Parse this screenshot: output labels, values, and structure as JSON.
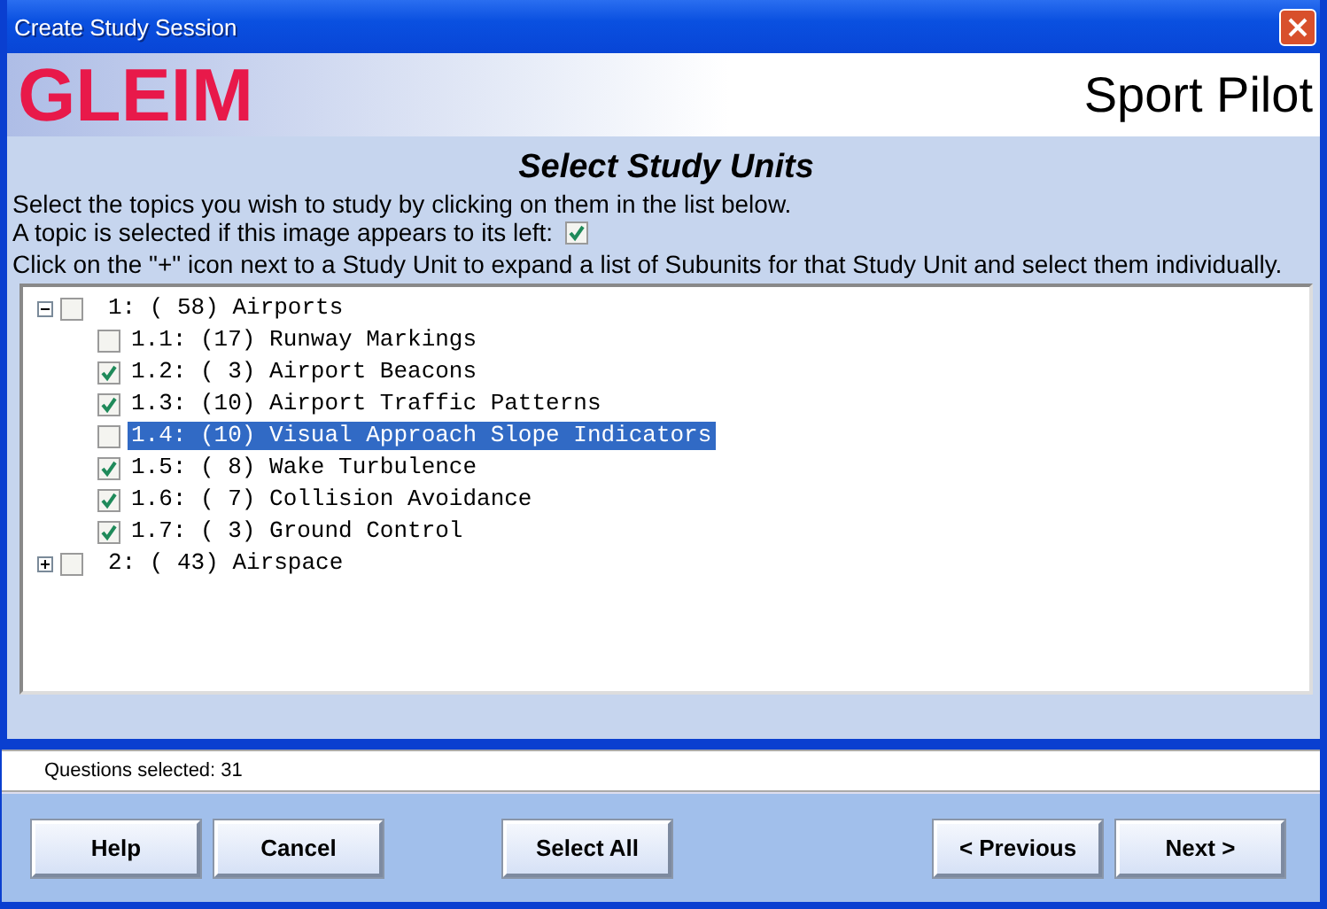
{
  "window": {
    "title": "Create Study Session"
  },
  "header": {
    "logo": "GLEIM",
    "product": "Sport Pilot"
  },
  "heading": "Select Study Units",
  "instructions": [
    "Select the topics you wish to study by clicking on them in the list below.",
    "A topic is selected if this image appears to its left:",
    "Click on the \"+\" icon next to a Study Unit to expand a list of Subunits for that Study Unit and select them individually."
  ],
  "legend_checked": true,
  "tree": [
    {
      "label": "1: ( 58) Airports",
      "expanded": true,
      "checked": false,
      "selected": false,
      "children": [
        {
          "label": "1.1: (17) Runway Markings",
          "checked": false,
          "selected": false
        },
        {
          "label": "1.2: ( 3) Airport Beacons",
          "checked": true,
          "selected": false
        },
        {
          "label": "1.3: (10) Airport Traffic Patterns",
          "checked": true,
          "selected": false
        },
        {
          "label": "1.4: (10) Visual Approach Slope Indicators",
          "checked": false,
          "selected": true
        },
        {
          "label": "1.5: ( 8) Wake Turbulence",
          "checked": true,
          "selected": false
        },
        {
          "label": "1.6: ( 7) Collision Avoidance",
          "checked": true,
          "selected": false
        },
        {
          "label": "1.7: ( 3) Ground Control",
          "checked": true,
          "selected": false
        }
      ]
    },
    {
      "label": "2: ( 43) Airspace",
      "expanded": false,
      "checked": false,
      "selected": false
    }
  ],
  "status_bar": "Questions selected: 31",
  "buttons_left": [
    "Help",
    "Cancel"
  ],
  "buttons_center": [
    "Select All"
  ],
  "buttons_right": [
    "< Previous",
    "Next >"
  ]
}
